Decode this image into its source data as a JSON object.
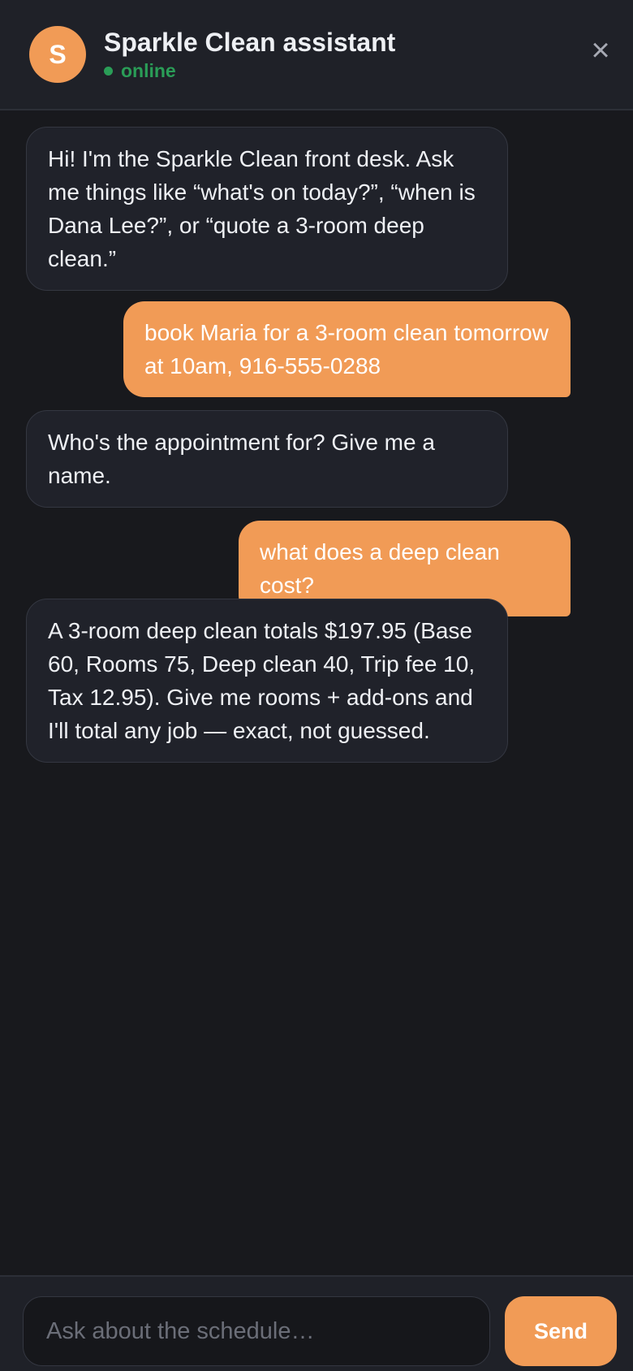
{
  "header": {
    "avatar_letter": "S",
    "title": "Sparkle Clean assistant",
    "status": "online",
    "close_glyph": "×"
  },
  "messages": [
    {
      "role": "bot",
      "text": "Hi! I'm the Sparkle Clean front desk. Ask me things like “what's on today?”, “when is Dana Lee?”, or “quote a 3-room deep clean.”"
    },
    {
      "role": "user",
      "text": "book Maria for a 3-room clean tomorrow at 10am, 916-555-0288"
    },
    {
      "role": "bot",
      "text": "Who's the appointment for? Give me a name."
    },
    {
      "role": "user",
      "text": "what does a deep clean cost?"
    },
    {
      "role": "bot",
      "text": "A 3-room deep clean totals $197.95 (Base 60, Rooms 75, Deep clean 40, Trip fee 10, Tax 12.95). Give me rooms + add-ons and I'll total any job — exact, not guessed."
    }
  ],
  "composer": {
    "value": "",
    "placeholder": "Ask about the schedule…",
    "send_label": "Send"
  },
  "colors": {
    "accent": "#f19b56",
    "online": "#2a9d57",
    "background": "#18191d",
    "bubble_bot": "#20222a"
  },
  "icons": {
    "close": "close-icon",
    "status": "status-dot-icon"
  }
}
